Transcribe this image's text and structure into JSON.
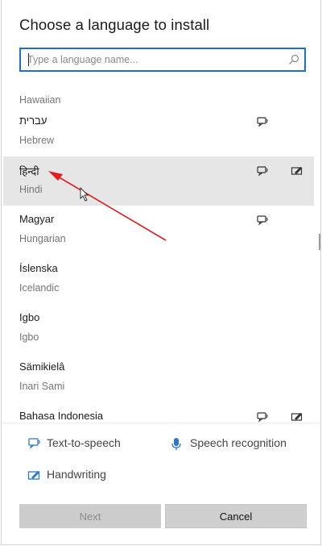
{
  "dialog": {
    "title": "Choose a language to install"
  },
  "search": {
    "placeholder": "Type a language name..."
  },
  "languages": [
    {
      "native": "",
      "english": "Hawaiian",
      "tts": false,
      "hw": false,
      "selected": false
    },
    {
      "native": "עברית",
      "english": "Hebrew",
      "tts": true,
      "hw": false,
      "selected": false
    },
    {
      "native": "हिन्दी",
      "english": "Hindi",
      "tts": true,
      "hw": true,
      "selected": true
    },
    {
      "native": "Magyar",
      "english": "Hungarian",
      "tts": true,
      "hw": false,
      "selected": false
    },
    {
      "native": "Íslenska",
      "english": "Icelandic",
      "tts": false,
      "hw": false,
      "selected": false
    },
    {
      "native": "Igbo",
      "english": "Igbo",
      "tts": false,
      "hw": false,
      "selected": false
    },
    {
      "native": "Sämikielâ",
      "english": "Inari Sami",
      "tts": false,
      "hw": false,
      "selected": false
    },
    {
      "native": "Bahasa Indonesia",
      "english": "",
      "tts": true,
      "hw": true,
      "selected": false
    }
  ],
  "legend": {
    "tts": "Text-to-speech",
    "speech": "Speech recognition",
    "handwriting": "Handwriting"
  },
  "buttons": {
    "next": "Next",
    "cancel": "Cancel"
  },
  "colors": {
    "accent": "#1e6fc8",
    "selected_row": "#e6e6e6",
    "arrow": "#e02020"
  }
}
